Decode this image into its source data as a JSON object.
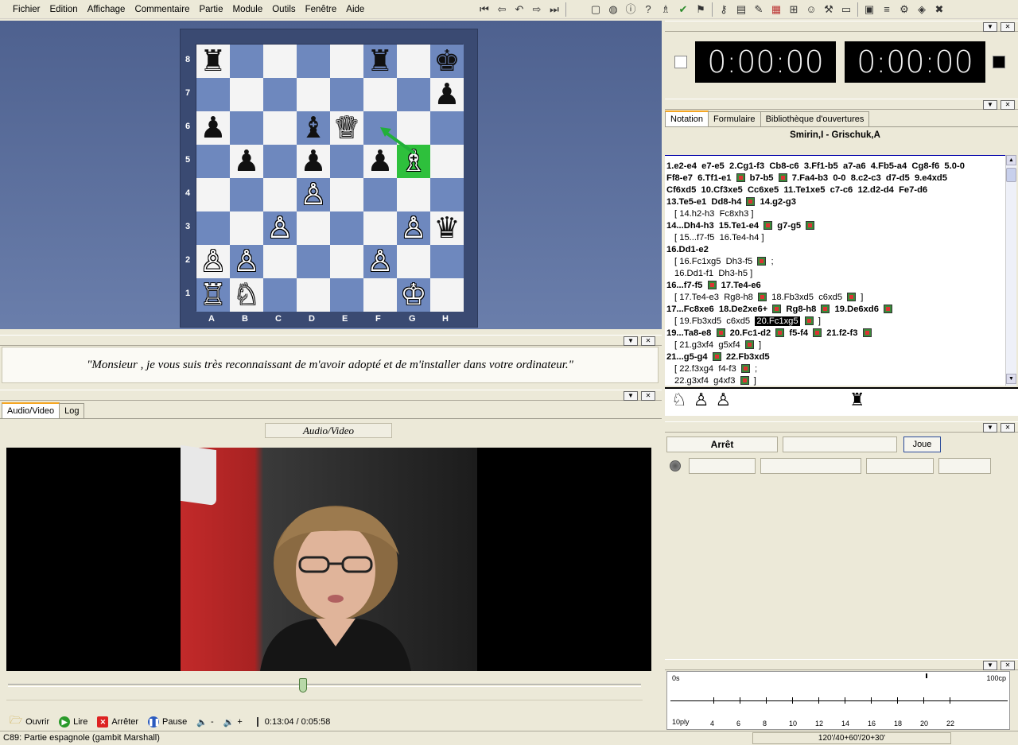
{
  "menu": [
    "Fichier",
    "Edition",
    "Affichage",
    "Commentaire",
    "Partie",
    "Module",
    "Outils",
    "Fenêtre",
    "Aide"
  ],
  "toolbar_nav_icons": [
    "first-move-icon",
    "prev-move-icon",
    "back-variation-icon",
    "next-move-icon",
    "last-move-icon"
  ],
  "toolbar_tool_icons": [
    "new-icon",
    "globe-icon",
    "info-icon",
    "question-icon",
    "board-icon",
    "check-icon",
    "flag-icon",
    "key-icon",
    "book-icon",
    "edit-icon",
    "calendar-icon",
    "grid-icon",
    "person-icon",
    "tools-icon",
    "window-icon",
    "save-icon",
    "options-icon",
    "engine-icon",
    "cube-icon",
    "close-icon"
  ],
  "board": {
    "rows": [
      [
        "♜",
        "",
        "",
        "",
        "",
        "♜",
        "",
        "♚"
      ],
      [
        "",
        "",
        "",
        "",
        "",
        "",
        "",
        "♟"
      ],
      [
        "♟",
        "",
        "",
        "♝",
        "♕",
        "",
        "",
        ""
      ],
      [
        "",
        "♟",
        "",
        "♟",
        "",
        "♟",
        "♗",
        ""
      ],
      [
        "",
        "",
        "",
        "♙",
        "",
        "",
        "",
        ""
      ],
      [
        "",
        "",
        "♙",
        "",
        "",
        "",
        "♙",
        "♛"
      ],
      [
        "♙",
        "♙",
        "",
        "",
        "",
        "♙",
        "",
        ""
      ],
      [
        "♖",
        "♘",
        "",
        "",
        "",
        "",
        "♔",
        ""
      ]
    ],
    "colors": [
      [
        "b",
        "",
        "",
        "",
        "",
        "b",
        "",
        "b"
      ],
      [
        "",
        "",
        "",
        "",
        "",
        "",
        "",
        "b"
      ],
      [
        "b",
        "",
        "",
        "b",
        "w",
        "",
        "",
        ""
      ],
      [
        "",
        "b",
        "",
        "b",
        "",
        "b",
        "w",
        ""
      ],
      [
        "",
        "",
        "",
        "w",
        "",
        "",
        "",
        ""
      ],
      [
        "",
        "",
        "w",
        "",
        "",
        "",
        "w",
        "b"
      ],
      [
        "w",
        "w",
        "",
        "",
        "",
        "w",
        "",
        ""
      ],
      [
        "w",
        "w",
        "",
        "",
        "",
        "",
        "w",
        ""
      ]
    ],
    "files": [
      "A",
      "B",
      "C",
      "D",
      "E",
      "F",
      "G",
      "H"
    ],
    "ranks": [
      "8",
      "7",
      "6",
      "5",
      "4",
      "3",
      "2",
      "1"
    ],
    "highlight": "g5",
    "arrow_color": "#22b03a"
  },
  "comment": "\"Monsieur , je vous suis très reconnaissant de m'avoir adopté et de m'installer dans votre ordinateur.\"",
  "media_tabs": [
    "Audio/Video",
    "Log"
  ],
  "media_title": "Audio/Video",
  "controls": {
    "open": "Ouvrir",
    "play": "Lire",
    "stop": "Arrêter",
    "pause": "Pause",
    "vol_down": "-",
    "vol_up": "+",
    "time": "0:13:04 / 0:05:58",
    "progress": 0.46
  },
  "status": {
    "opening": "C89: Partie espagnole (gambit Marshall)",
    "time_control": "120'/40+60'/20+30'"
  },
  "clocks": {
    "white": "0:00:00",
    "black": "0:00:00"
  },
  "notation_tabs": [
    "Notation",
    "Formulaire",
    "Bibliothèque d'ouvertures"
  ],
  "game_title": "Smirin,I - Grischuk,A",
  "notation_lines": [
    {
      "type": "main",
      "text": "1.e2-e4  e7-e5  2.Cg1-f3  Cb8-c6  3.Ff1-b5  a7-a6  4.Fb5-a4  Cg8-f6  5.0-0"
    },
    {
      "type": "main",
      "text": "Ff8-e7  6.Tf1-e1 ■ b7-b5 ■ 7.Fa4-b3  0-0  8.c2-c3  d7-d5  9.e4xd5"
    },
    {
      "type": "main",
      "text": "Cf6xd5  10.Cf3xe5  Cc6xe5  11.Te1xe5  c7-c6  12.d2-d4  Fe7-d6"
    },
    {
      "type": "main",
      "text": "13.Te5-e1  Dd8-h4 ■ 14.g2-g3"
    },
    {
      "type": "var",
      "text": "[ 14.h2-h3  Fc8xh3 ]"
    },
    {
      "type": "main",
      "text": "14...Dh4-h3  15.Te1-e4 ■ g7-g5 ■"
    },
    {
      "type": "var",
      "text": "[ 15...f7-f5  16.Te4-h4 ]"
    },
    {
      "type": "main",
      "text": "16.Dd1-e2"
    },
    {
      "type": "var",
      "text": "[ 16.Fc1xg5  Dh3-f5 ■ ;"
    },
    {
      "type": "var",
      "text": "16.Dd1-f1  Dh3-h5 ]"
    },
    {
      "type": "main",
      "text": "16...f7-f5 ■ 17.Te4-e6"
    },
    {
      "type": "var",
      "text": "[ 17.Te4-e3  Rg8-h8 ■ 18.Fb3xd5  c6xd5 ■ ]"
    },
    {
      "type": "main",
      "text": "17...Fc8xe6  18.De2xe6+ ■ Rg8-h8 ■ 19.De6xd6 ■"
    },
    {
      "type": "var",
      "text": "[ 19.Fb3xd5  c6xd5  ▶20.Fc1xg5◀ ■ ]"
    },
    {
      "type": "main",
      "text": "19...Ta8-e8 ■ 20.Fc1-d2 ■ f5-f4 ■ 21.f2-f3 ■"
    },
    {
      "type": "var",
      "text": "[ 21.g3xf4  g5xf4 ■ ]"
    },
    {
      "type": "main",
      "text": "21...g5-g4 ■ 22.Fb3xd5"
    },
    {
      "type": "var",
      "text": "[ 22.f3xg4  f4-f3 ■ ;"
    },
    {
      "type": "var",
      "text": "22.g3xf4  g4xf3 ■ ]"
    }
  ],
  "captured_white": [
    "♘",
    "♙",
    "♙"
  ],
  "captured_black": [
    "♜"
  ],
  "engine": {
    "stop_label": "Arrêt",
    "play_label": "Joue"
  },
  "graph": {
    "y_top": "0s",
    "y_right": "100cp",
    "x_left": "10ply",
    "ticks": [
      "4",
      "6",
      "8",
      "10",
      "12",
      "14",
      "16",
      "18",
      "20",
      "22"
    ]
  }
}
